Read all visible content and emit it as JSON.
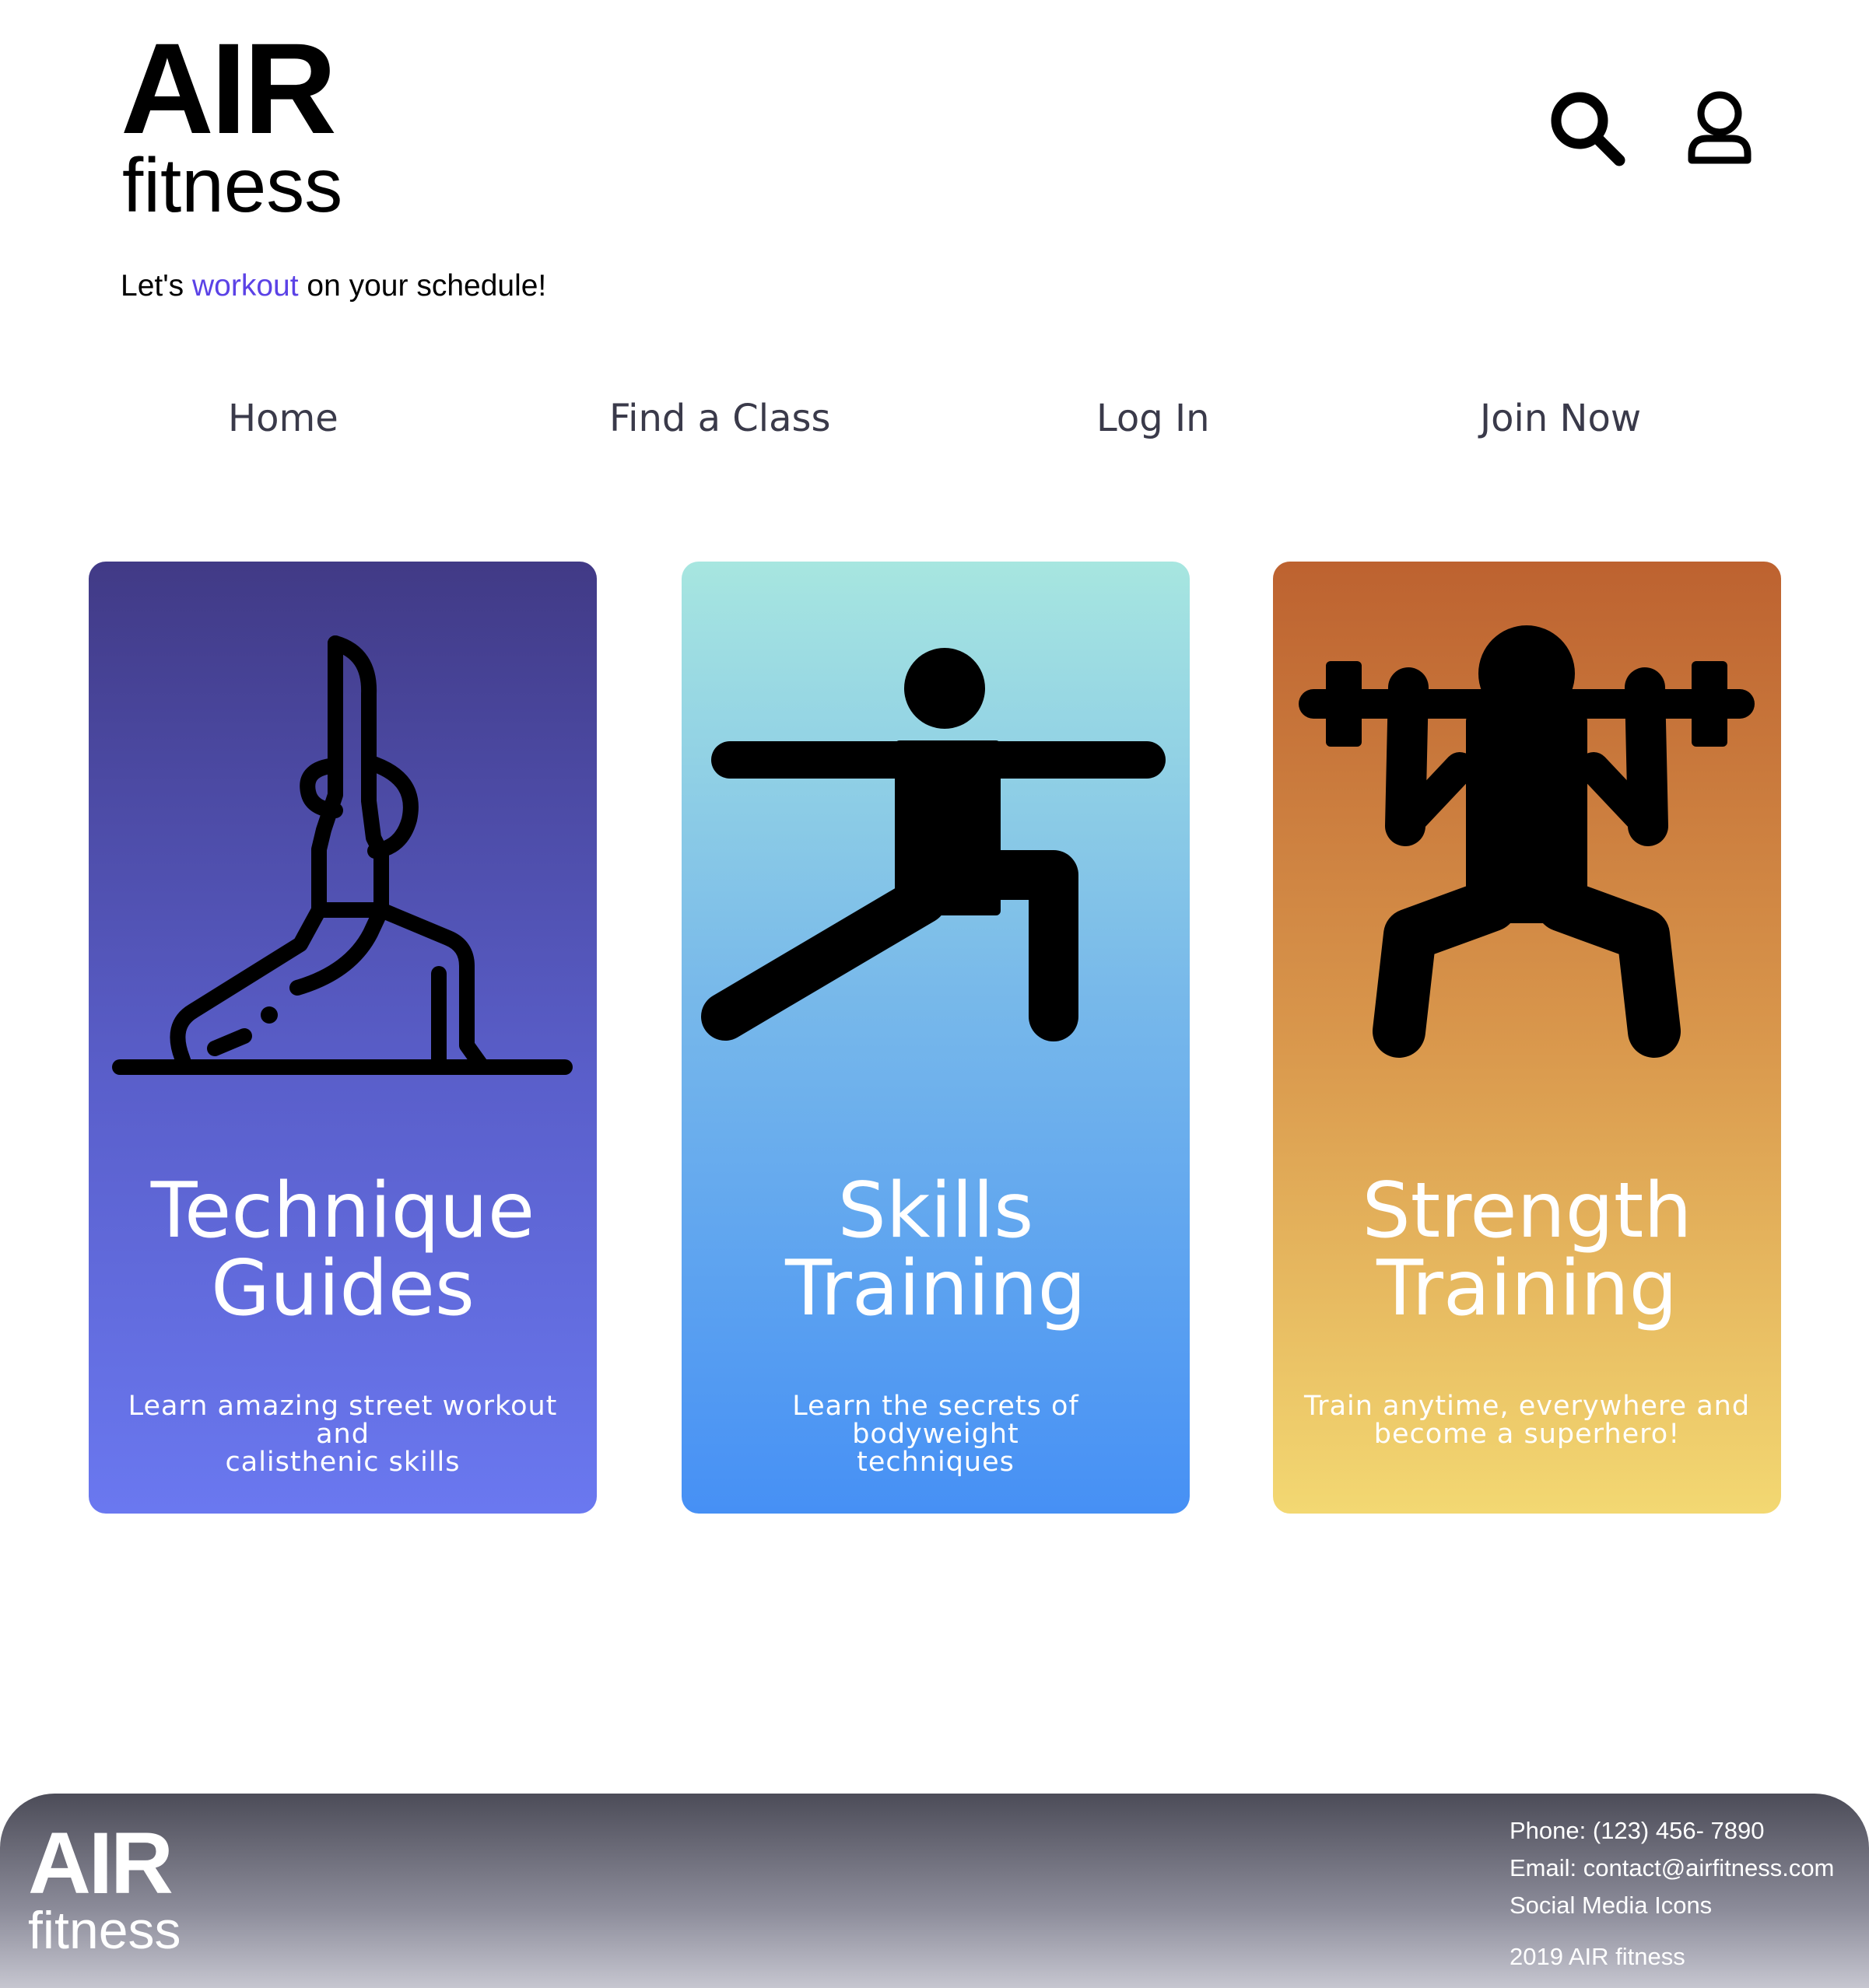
{
  "header": {
    "logo_air": "AIR",
    "logo_fitness": "fitness",
    "tagline": {
      "before": "Let's ",
      "accent": "workout",
      "after": " on your schedule!"
    },
    "accent_color": "#5b42e6",
    "icons": [
      "search-icon",
      "user-icon"
    ]
  },
  "nav": {
    "items": [
      {
        "label": "Home"
      },
      {
        "label": "Find a Class"
      },
      {
        "label": "Log In"
      },
      {
        "label": "Join Now"
      }
    ]
  },
  "cards": [
    {
      "title_line1": "Technique",
      "title_line2": "Guides",
      "desc_line1": "Learn amazing street workout and",
      "desc_line2": "calisthenic skills",
      "icon": "yoga-pose-icon",
      "colors": [
        "#413a86",
        "#6a78f0"
      ]
    },
    {
      "title_line1": "Skills",
      "title_line2": "Training",
      "desc_line1": "Learn the secrets of bodyweight",
      "desc_line2": "techniques",
      "icon": "lunge-stretch-icon",
      "colors": [
        "#a7e6e0",
        "#4690f5"
      ]
    },
    {
      "title_line1": "Strength",
      "title_line2": "Training",
      "desc_line1": "Train anytime, everywhere and",
      "desc_line2": "become a superhero!",
      "icon": "weightlifter-icon",
      "colors": [
        "#bd6230",
        "#f3d872"
      ]
    }
  ],
  "footer": {
    "logo_air": "AIR",
    "logo_fitness": "fitness",
    "phone": "Phone: (123) 456- 7890",
    "email": "Email: contact@airfitness.com",
    "social": "Social Media Icons",
    "copyright": "2019 AIR fitness"
  }
}
